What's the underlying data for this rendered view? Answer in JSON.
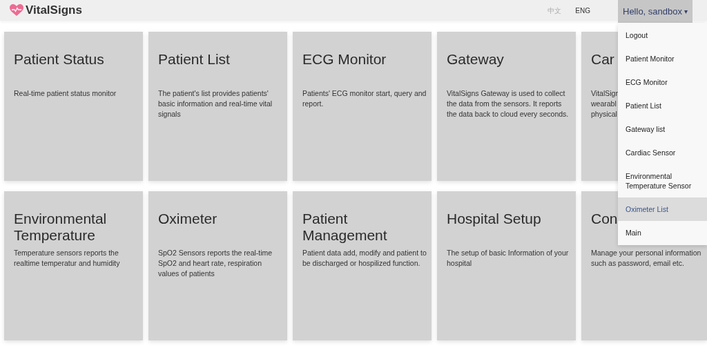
{
  "header": {
    "logo": "VitalSigns",
    "languages": [
      {
        "label": "中文",
        "selected": false
      },
      {
        "label": "ENG",
        "selected": true
      }
    ],
    "user_menu": {
      "label": "Hello, sandbox",
      "caret": "▾",
      "expanded": true
    }
  },
  "cards": [
    {
      "title": "Patient Status",
      "lines": [
        "Real-time patient status monitor"
      ]
    },
    {
      "title": "Patient List",
      "lines": [
        "The patient's list provides patients'",
        "basic information and real-time vital",
        "signals"
      ]
    },
    {
      "title": "ECG Monitor",
      "lines": [
        "Patients' ECG monitor start, query and",
        "report."
      ]
    },
    {
      "title": "Gateway",
      "lines": [
        "VitalSigns Gateway is used to collect",
        "the data from the sensors. It reports",
        "the data back to cloud every seconds."
      ]
    },
    {
      "title": "Car",
      "lines": [
        "VitalSign",
        "wearabl",
        "physical"
      ]
    },
    {
      "title": "Environmental Temperature",
      "lines": [
        "Temperature sensors reports the",
        "realtime temperatur and humidity"
      ]
    },
    {
      "title": "Oximeter",
      "lines": [
        "SpO2 Sensors reports the real-time",
        "SpO2 and heart rate, respiration",
        "values of patients"
      ]
    },
    {
      "title": "Patient Management",
      "lines": [
        "Patient data add, modify and patient to",
        "be discharged or hospilized function."
      ]
    },
    {
      "title": "Hospital Setup",
      "lines": [
        "The setup of basic Information of your",
        "hospital"
      ]
    },
    {
      "title": "Con",
      "lines": [
        "Manage your personal information",
        "such as password, email etc."
      ]
    }
  ],
  "dropdown": [
    {
      "label": "Logout",
      "selected": false
    },
    {
      "label": "Patient Monitor",
      "selected": false
    },
    {
      "label": "ECG Monitor",
      "selected": false
    },
    {
      "label": "Patient List",
      "selected": false
    },
    {
      "label": "Gateway list",
      "selected": false
    },
    {
      "label": "Cardiac Sensor",
      "selected": false
    },
    {
      "label": "Environmental Temperature Sensor",
      "selected": false
    },
    {
      "label": "Oximeter List",
      "selected": true
    },
    {
      "label": "Main",
      "selected": false
    }
  ]
}
